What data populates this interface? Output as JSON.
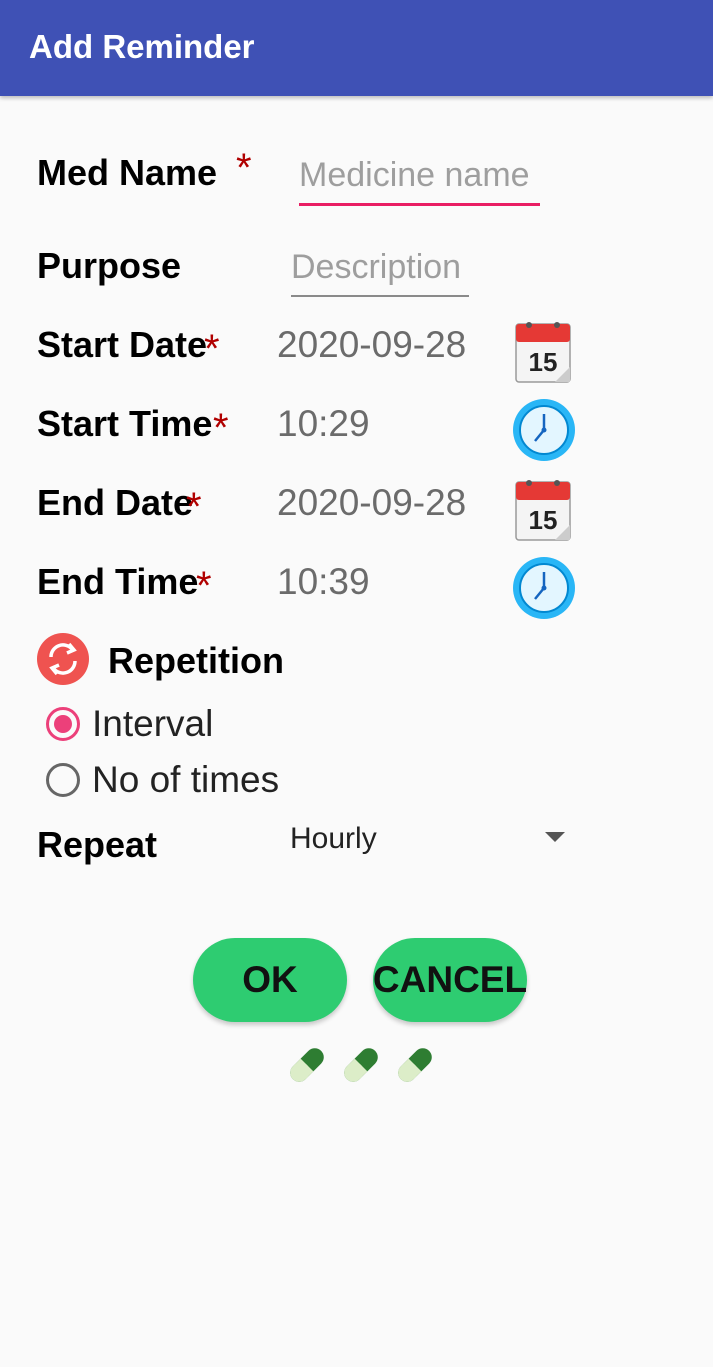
{
  "appbar": {
    "title": "Add Reminder"
  },
  "form": {
    "med_name": {
      "label": "Med Name",
      "required": "*",
      "placeholder": "Medicine name"
    },
    "purpose": {
      "label": "Purpose",
      "placeholder": "Description"
    },
    "start_date": {
      "label": "Start Date",
      "required": "*",
      "value": "2020-09-28",
      "icon": "calendar-icon"
    },
    "start_time": {
      "label": "Start Time",
      "required": "*",
      "value": "10:29",
      "icon": "clock-icon"
    },
    "end_date": {
      "label": "End Date",
      "required": "*",
      "value": "2020-09-28",
      "icon": "calendar-icon"
    },
    "end_time": {
      "label": "End Time",
      "required": "*",
      "value": "10:39",
      "icon": "clock-icon"
    }
  },
  "repetition": {
    "title": "Repetition",
    "icon": "repeat-icon",
    "options": [
      {
        "label": "Interval",
        "checked": true
      },
      {
        "label": "No of times",
        "checked": false
      }
    ]
  },
  "repeat": {
    "label": "Repeat",
    "selected": "Hourly"
  },
  "buttons": {
    "ok": "OK",
    "cancel": "CANCEL"
  },
  "decoration": {
    "icons": [
      "pill-icon",
      "pill-icon",
      "pill-icon"
    ]
  },
  "colors": {
    "appbar": "#3f51b5",
    "accent": "#e91e63",
    "button": "#2ecc71",
    "required": "#b00000"
  }
}
